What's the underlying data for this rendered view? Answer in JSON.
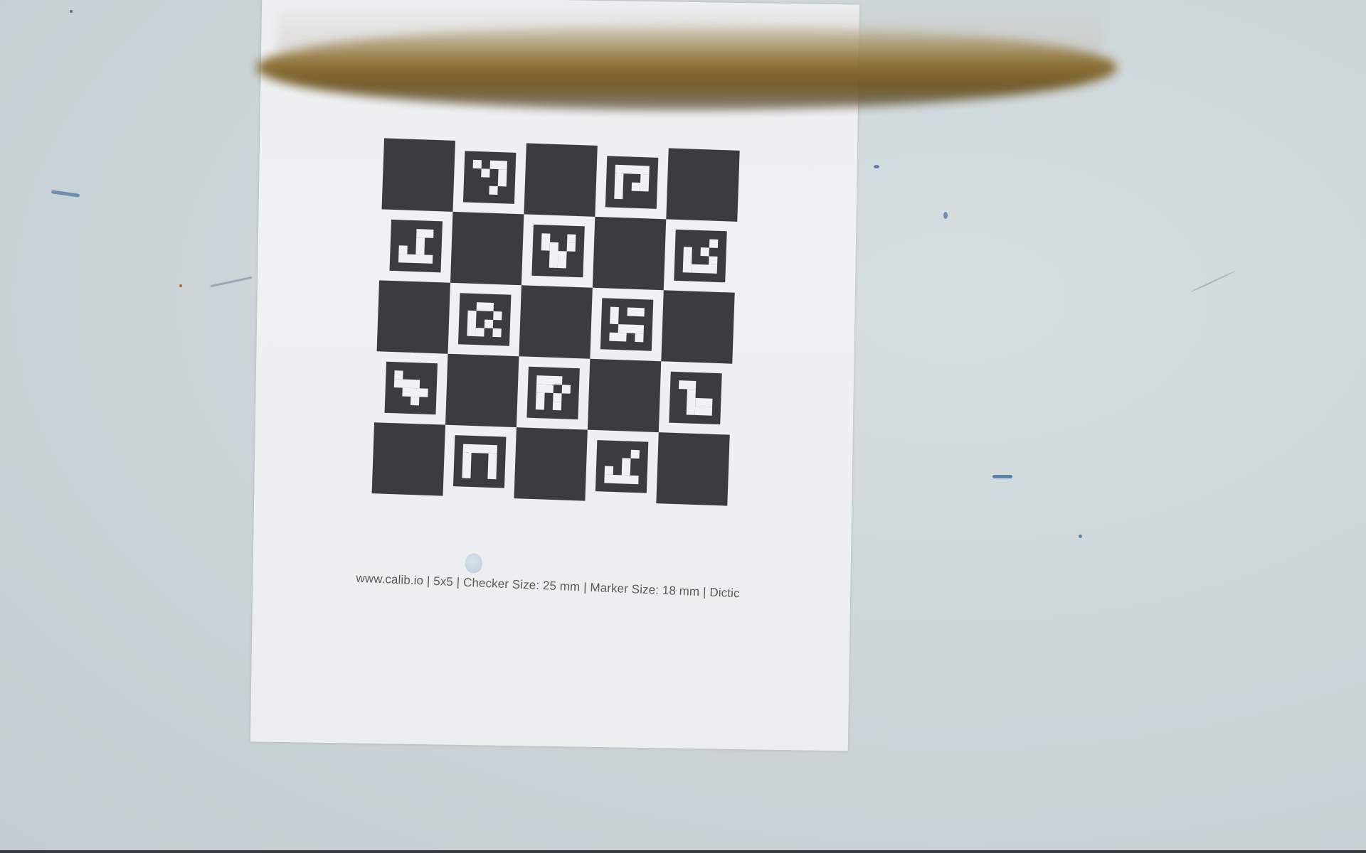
{
  "scene": {
    "description_kind": "photo",
    "caption_text": "www.calib.io | 5x5 | Checker Size: 25 mm | Marker Size: 18 mm | Dictic",
    "board": {
      "rows": 5,
      "cols": 5,
      "dark_color": "#3c3c40",
      "paper_color": "#eef0f2"
    },
    "colors": {
      "background": "#c9d3d6",
      "ring": "#8a6d2e"
    }
  }
}
